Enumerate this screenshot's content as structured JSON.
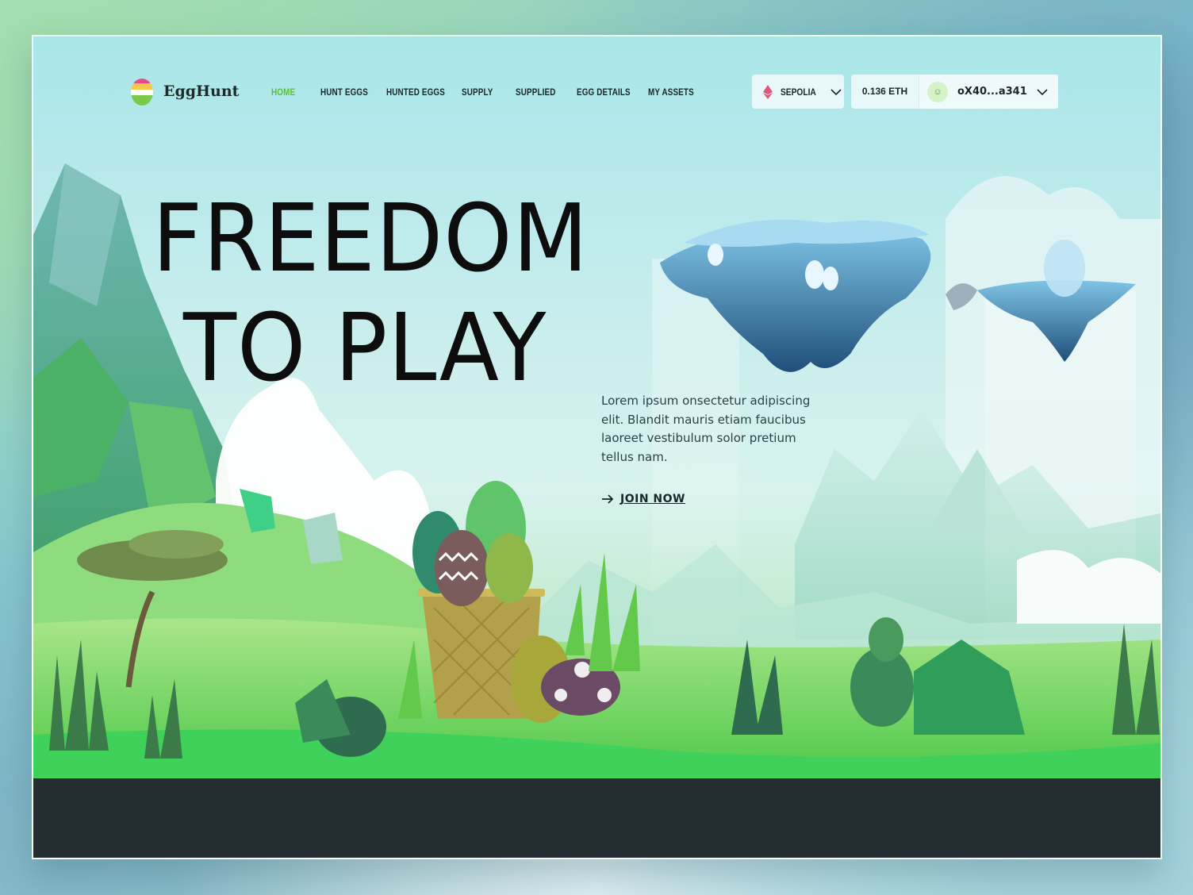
{
  "brand": {
    "name": "EggHunt"
  },
  "nav": {
    "links": [
      {
        "label": "HOME",
        "active": true
      },
      {
        "label": "HUNT EGGS",
        "active": false
      },
      {
        "label": "HUNTED EGGS",
        "active": false
      },
      {
        "label": "SUPPLY",
        "active": false
      },
      {
        "label": "SUPPLIED",
        "active": false
      },
      {
        "label": "EGG DETAILS",
        "active": false
      },
      {
        "label": "MY ASSETS",
        "active": false
      }
    ]
  },
  "network": {
    "label": "SEPOLIA",
    "icon": "ethereum-icon"
  },
  "wallet": {
    "balance": "0.136 ETH",
    "address": "oX40...a341",
    "icon": "user-icon"
  },
  "hero": {
    "title_line1": "FREEDOM",
    "title_line2": "TO PLAY",
    "description": "Lorem ipsum onsectetur adipiscing elit. Blandit mauris etiam faucibus laoreet vestibulum solor pretium tellus nam.",
    "cta_label": "JOIN NOW"
  },
  "colors": {
    "accent": "#5cbf3a",
    "text": "#17262a",
    "ground": "#7fd86a",
    "band": "#242e32"
  }
}
